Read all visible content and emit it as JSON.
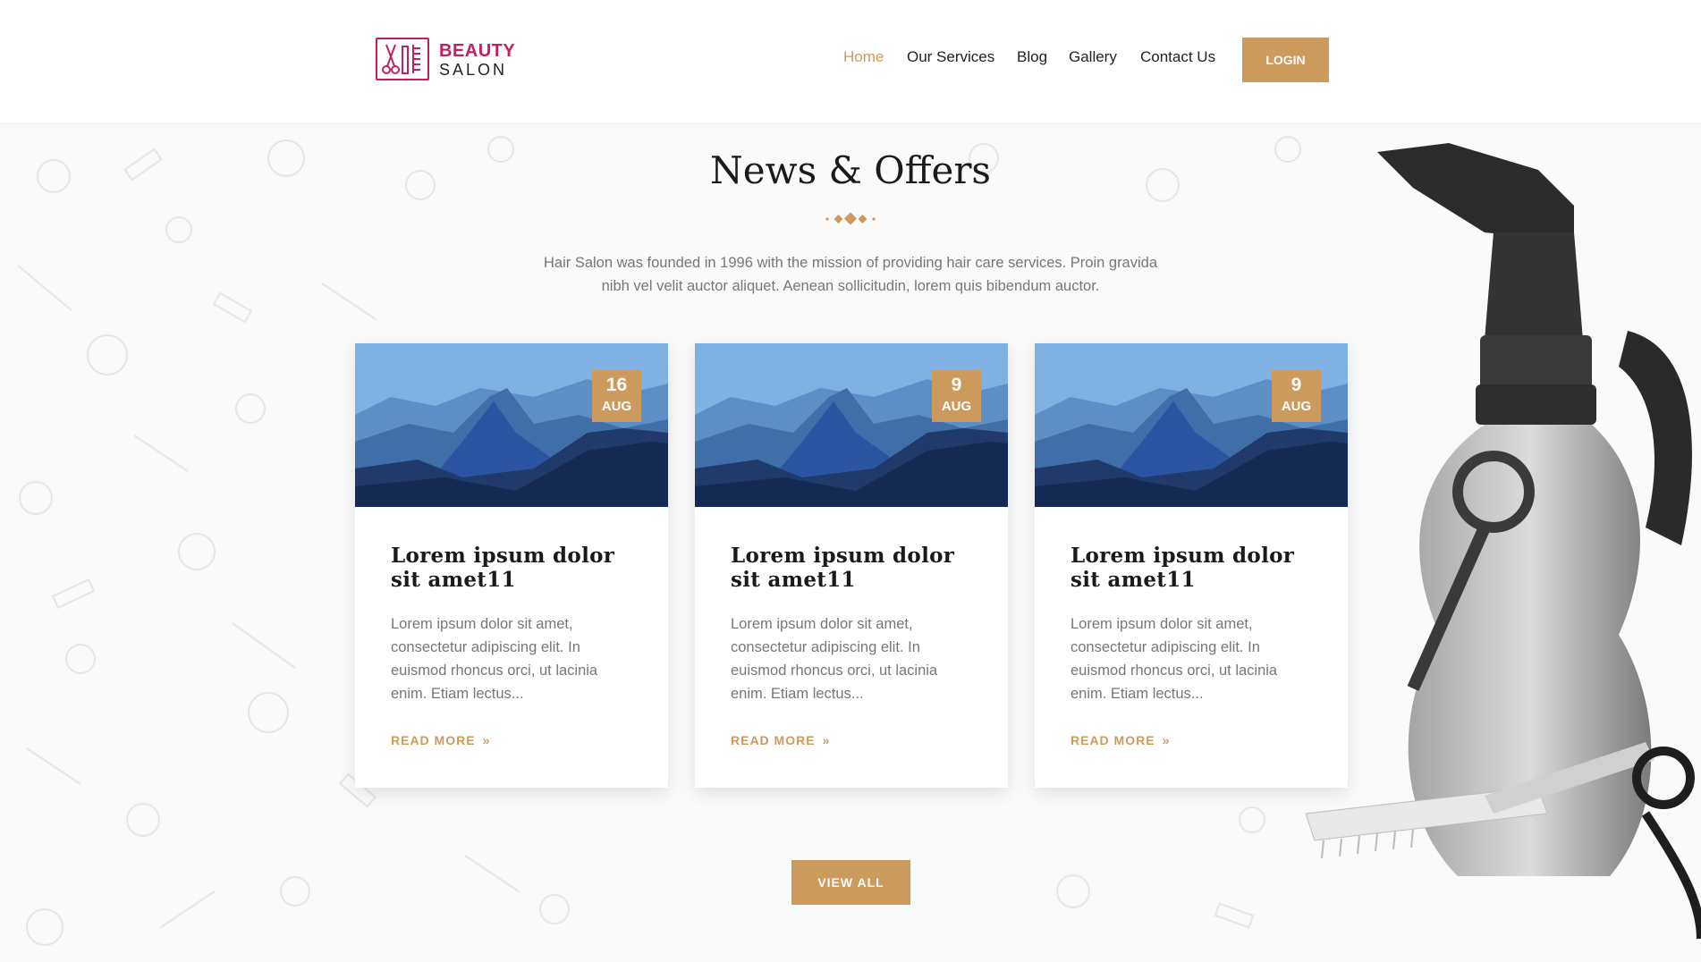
{
  "logo": {
    "line1": "BEAUTY",
    "line2": "SALON"
  },
  "nav": {
    "items": [
      {
        "label": "Home",
        "active": true
      },
      {
        "label": "Our Services",
        "active": false
      },
      {
        "label": "Blog",
        "active": false
      },
      {
        "label": "Gallery",
        "active": false
      },
      {
        "label": "Contact Us",
        "active": false
      }
    ],
    "login_label": "LOGIN"
  },
  "section": {
    "title": "News & Offers",
    "description": "Hair Salon was founded in 1996 with the mission of providing hair care services. Proin gravida nibh vel velit auctor aliquet. Aenean sollicitudin, lorem quis bibendum auctor."
  },
  "cards": [
    {
      "day": "16",
      "month": "AUG",
      "title": "Lorem ipsum dolor sit amet11",
      "text": "Lorem ipsum dolor sit amet, consectetur adipiscing elit. In euismod rhoncus orci, ut lacinia enim. Etiam lectus...",
      "read_more": "READ MORE"
    },
    {
      "day": "9",
      "month": "AUG",
      "title": "Lorem ipsum dolor sit amet11",
      "text": "Lorem ipsum dolor sit amet, consectetur adipiscing elit. In euismod rhoncus orci, ut lacinia enim. Etiam lectus...",
      "read_more": "READ MORE"
    },
    {
      "day": "9",
      "month": "AUG",
      "title": "Lorem ipsum dolor sit amet11",
      "text": "Lorem ipsum dolor sit amet, consectetur adipiscing elit. In euismod rhoncus orci, ut lacinia enim. Etiam lectus...",
      "read_more": "READ MORE"
    }
  ],
  "view_all_label": "VIEW ALL",
  "colors": {
    "accent": "#cd9a5e",
    "brand": "#c21f63",
    "heading": "#1a1a1a",
    "body_text": "#777777"
  },
  "icons": {
    "logo": "scissors-comb-logo-icon",
    "divider": "diamond-divider-icon",
    "read_more": "double-chevron-right-icon"
  }
}
